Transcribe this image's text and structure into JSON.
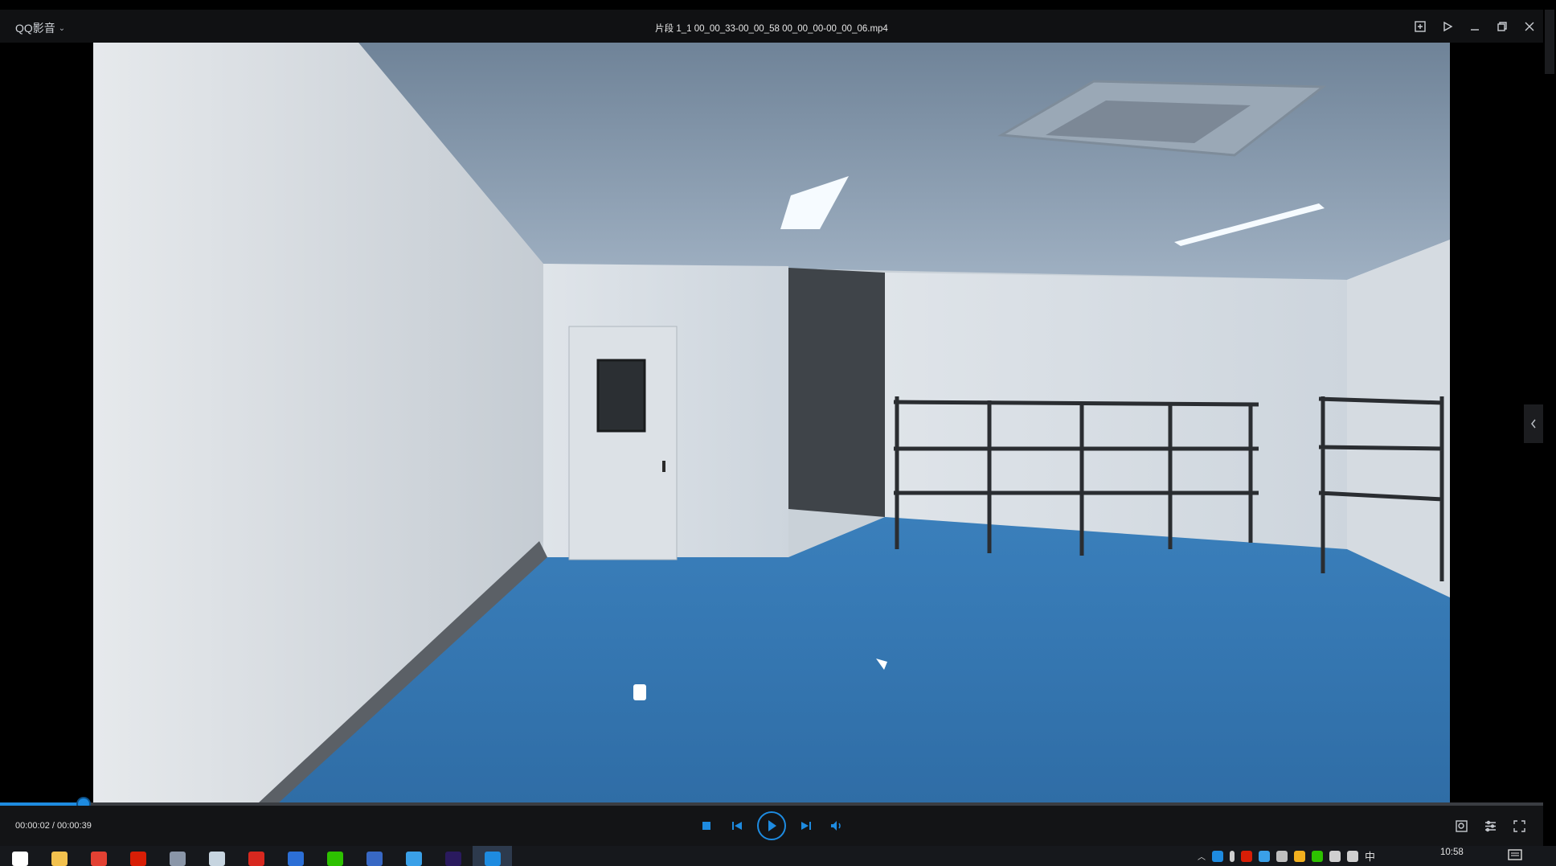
{
  "app": {
    "name": "QQ影音",
    "file_title": "片段 1_1 00_00_33-00_00_58 00_00_00-00_00_06.mp4"
  },
  "window_controls": {
    "icons": [
      "screenshot-icon",
      "pin-icon",
      "minimize-icon",
      "restore-icon",
      "close-icon"
    ]
  },
  "playback": {
    "time_display": "00:00:02 / 00:00:39",
    "progress_fraction": 0.05,
    "state": "paused"
  },
  "controls": {
    "icons": [
      "stop-icon",
      "previous-icon",
      "play-icon",
      "next-icon",
      "volume-icon"
    ],
    "right_icons": [
      "screenshot-icon",
      "settings-icon",
      "fullscreen-icon"
    ]
  },
  "taskbar": {
    "apps": [
      {
        "name": "windows-start",
        "color": "#ffffff"
      },
      {
        "name": "file-explorer",
        "color": "#f2c14e"
      },
      {
        "name": "chrome",
        "color": "#e34133"
      },
      {
        "name": "netease-music",
        "color": "#d81e06"
      },
      {
        "name": "calculator",
        "color": "#8a96a8"
      },
      {
        "name": "steam",
        "color": "#c7d5e0"
      },
      {
        "name": "wps",
        "color": "#d8281f"
      },
      {
        "name": "stock-app",
        "color": "#2c6fd6"
      },
      {
        "name": "wechat",
        "color": "#2dc100"
      },
      {
        "name": "revit",
        "color": "#3868c4"
      },
      {
        "name": "search-app",
        "color": "#3aa0e8"
      },
      {
        "name": "premiere-pro",
        "color": "#2a1a5e"
      },
      {
        "name": "qq-player",
        "color": "#1e8be0"
      }
    ],
    "tray_ime": "中",
    "clock": "10:58"
  },
  "colors": {
    "accent": "#1e8be0",
    "titlebar": "#101113",
    "controlbar": "#131416"
  }
}
